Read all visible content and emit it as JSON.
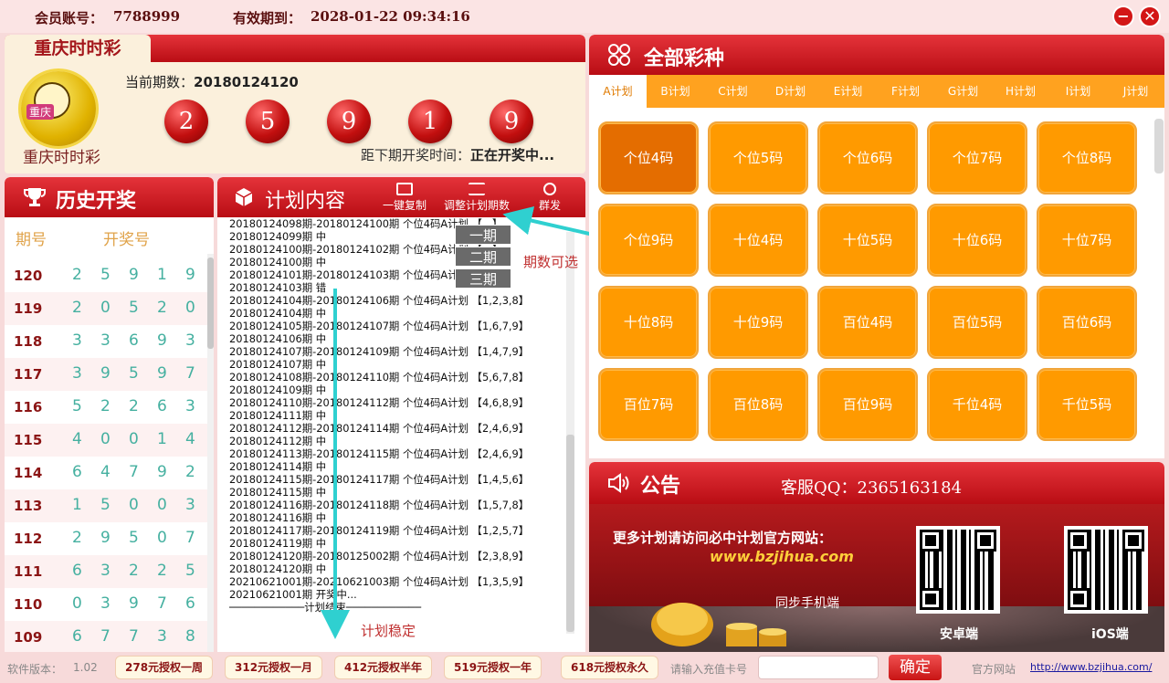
{
  "topbar": {
    "account_label": "会员账号：",
    "account": "7788999",
    "expire_label": "有效期到：",
    "expire": "2028-01-22 09:34:16"
  },
  "lottery": {
    "tab": "重庆时时彩",
    "logo_badge": "重庆",
    "name": "重庆时时彩",
    "period_label": "当前期数：",
    "period": "20180124120",
    "balls": [
      "2",
      "5",
      "9",
      "1",
      "9"
    ],
    "next_label": "距下期开奖时间：",
    "next_status": "正在开奖中..."
  },
  "history": {
    "title": "历史开奖",
    "col_period": "期号",
    "col_numbers": "开奖号",
    "rows": [
      {
        "p": "120",
        "n": [
          "2",
          "5",
          "9",
          "1",
          "9"
        ]
      },
      {
        "p": "119",
        "n": [
          "2",
          "0",
          "5",
          "2",
          "0"
        ]
      },
      {
        "p": "118",
        "n": [
          "3",
          "3",
          "6",
          "9",
          "3"
        ]
      },
      {
        "p": "117",
        "n": [
          "3",
          "9",
          "5",
          "9",
          "7"
        ]
      },
      {
        "p": "116",
        "n": [
          "5",
          "2",
          "2",
          "6",
          "3"
        ]
      },
      {
        "p": "115",
        "n": [
          "4",
          "0",
          "0",
          "1",
          "4"
        ]
      },
      {
        "p": "114",
        "n": [
          "6",
          "4",
          "7",
          "9",
          "2"
        ]
      },
      {
        "p": "113",
        "n": [
          "1",
          "5",
          "0",
          "0",
          "3"
        ]
      },
      {
        "p": "112",
        "n": [
          "2",
          "9",
          "5",
          "0",
          "7"
        ]
      },
      {
        "p": "111",
        "n": [
          "6",
          "3",
          "2",
          "2",
          "5"
        ]
      },
      {
        "p": "110",
        "n": [
          "0",
          "3",
          "9",
          "7",
          "6"
        ]
      },
      {
        "p": "109",
        "n": [
          "6",
          "7",
          "7",
          "3",
          "8"
        ]
      }
    ]
  },
  "plan": {
    "title": "计划内容",
    "tools": {
      "copy": "一键复制",
      "adjust": "调整计划期数",
      "send": "群发"
    },
    "period_options": [
      "一期",
      "二期",
      "三期"
    ],
    "lines": [
      "20180124098期-20180124100期  个位4码A计划  【...】",
      "20180124099期  中",
      "20180124100期-20180124102期  个位4码A计划  【...】",
      "20180124100期  中",
      "20180124101期-20180124103期  个位4码A计划  【...】",
      "20180124103期  错",
      "20180124104期-20180124106期  个位4码A计划  【1,2,3,8】",
      "20180124104期  中",
      "20180124105期-20180124107期  个位4码A计划  【1,6,7,9】",
      "20180124106期  中",
      "20180124107期-20180124109期  个位4码A计划  【1,4,7,9】",
      "20180124107期  中",
      "20180124108期-20180124110期  个位4码A计划  【5,6,7,8】",
      "20180124109期  中",
      "20180124110期-20180124112期  个位4码A计划  【4,6,8,9】",
      "20180124111期  中",
      "20180124112期-20180124114期  个位4码A计划  【2,4,6,9】",
      "20180124112期  中",
      "20180124113期-20180124115期  个位4码A计划  【2,4,6,9】",
      "20180124114期  中",
      "20180124115期-20180124117期  个位4码A计划  【1,4,5,6】",
      "20180124115期  中",
      "20180124116期-20180124118期  个位4码A计划  【1,5,7,8】",
      "20180124116期  中",
      "20180124117期-20180124119期  个位4码A计划  【1,2,5,7】",
      "20180124119期  中",
      "20180124120期-20180125002期  个位4码A计划  【2,3,8,9】",
      "20180124120期  中",
      "20210621001期-20210621003期  个位4码A计划  【1,3,5,9】",
      "20210621001期  开奖中...",
      "────────────计划结束────────────"
    ],
    "annotation_period": "期数可选",
    "annotation_stable": "计划稳定"
  },
  "all": {
    "title": "全部彩种",
    "tabs": [
      "A计划",
      "B计划",
      "C计划",
      "D计划",
      "E计划",
      "F计划",
      "G计划",
      "H计划",
      "I计划",
      "J计划"
    ],
    "cells": [
      "个位4码",
      "个位5码",
      "个位6码",
      "个位7码",
      "个位8码",
      "个位9码",
      "十位4码",
      "十位5码",
      "十位6码",
      "十位7码",
      "十位8码",
      "十位9码",
      "百位4码",
      "百位5码",
      "百位6码",
      "百位7码",
      "百位8码",
      "百位9码",
      "千位4码",
      "千位5码"
    ]
  },
  "notice": {
    "title": "公告",
    "qq": "客服QQ：2365163184",
    "banner": "更多计划请访问必中计划官方网站：",
    "site": "www.bzjihua.com",
    "sync": "同步手机端",
    "android": "安卓端",
    "ios": "iOS端"
  },
  "footer": {
    "version_label": "软件版本：",
    "version": "1.02",
    "plans": [
      "278元授权一周",
      "312元授权一月",
      "412元授权半年",
      "519元授权一年",
      "618元授权永久"
    ],
    "card_placeholder": "请输入充值卡号",
    "confirm": "确定",
    "site_label": "官方网站",
    "site_link": "http://www.bzjihua.com/"
  },
  "colors": {
    "header_red": "#c8161d",
    "ball_red": "#c20f0f",
    "orange": "#ff9a00",
    "selected_orange": "#e46d00",
    "annotation_cyan": "#2fd0d0"
  }
}
